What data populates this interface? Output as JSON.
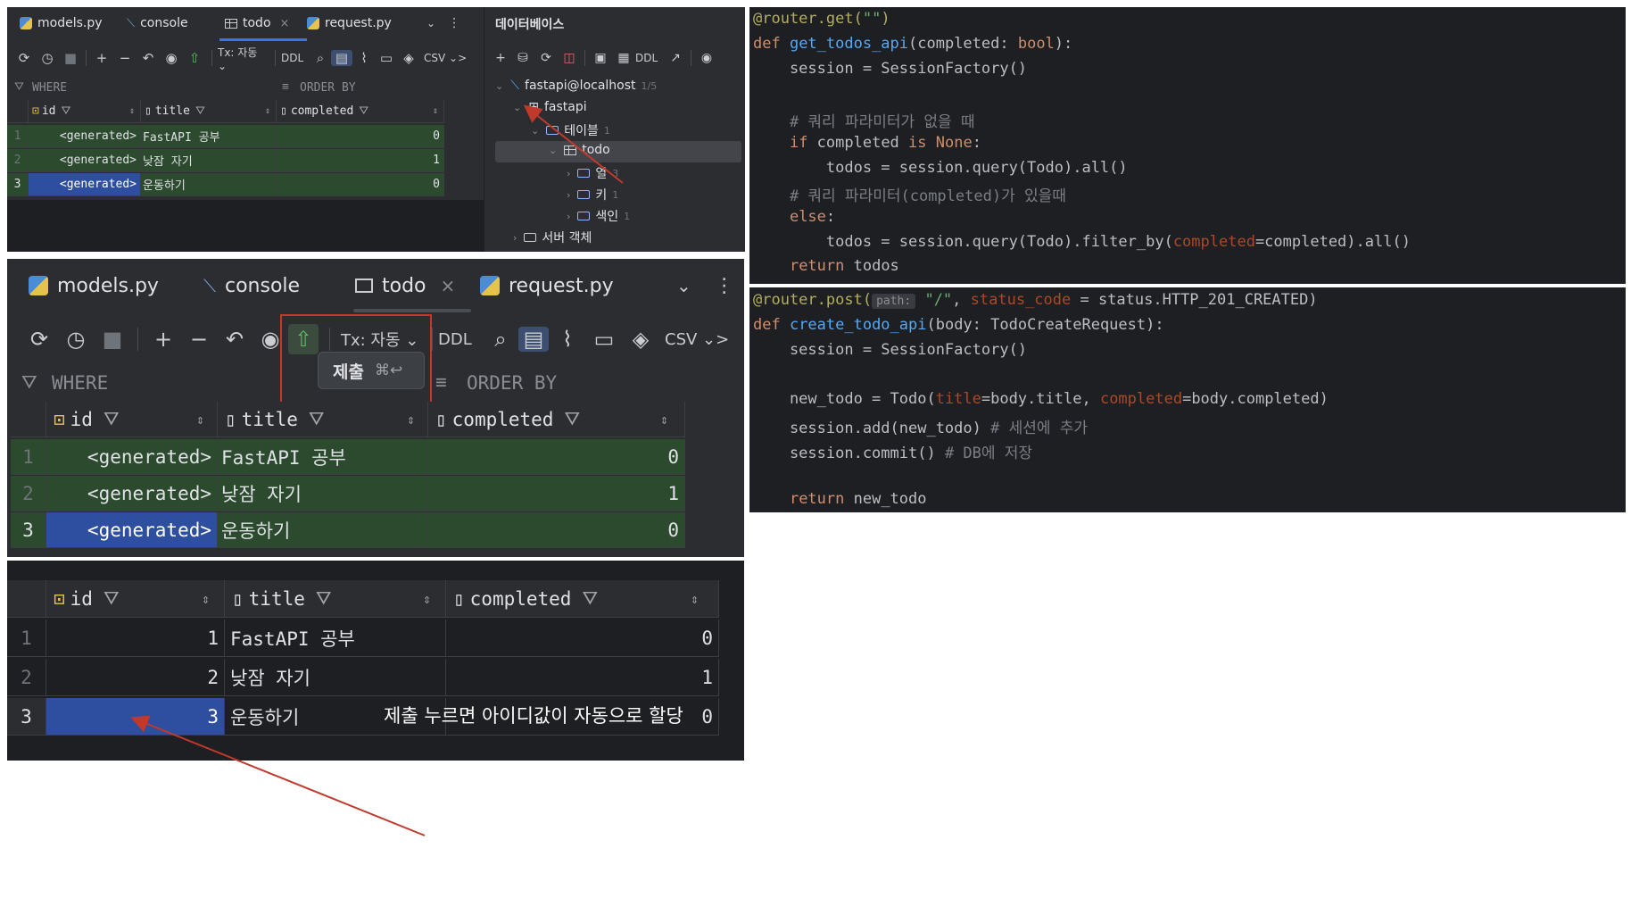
{
  "panel1": {
    "tabs": [
      {
        "label": "models.py",
        "icon": "python-file-icon"
      },
      {
        "label": "console",
        "icon": "console-icon"
      },
      {
        "label": "todo",
        "icon": "table-icon",
        "active": true
      },
      {
        "label": "request.py",
        "icon": "python-file-icon"
      }
    ],
    "tx_label": "Tx: 자동",
    "ddl_label": "DDL",
    "csv_label": "CSV",
    "where_label": "WHERE",
    "orderby_label": "ORDER BY",
    "columns": [
      "id",
      "title",
      "completed"
    ],
    "rows": [
      {
        "num": "1",
        "id": "<generated>",
        "title": "FastAPI 공부",
        "completed": "0"
      },
      {
        "num": "2",
        "id": "<generated>",
        "title": "낮잠 자기",
        "completed": "1"
      },
      {
        "num": "3",
        "id": "<generated>",
        "title": "운동하기",
        "completed": "0"
      }
    ]
  },
  "db_panel": {
    "title": "데이터베이스",
    "ddl_label": "DDL",
    "tree": {
      "connection": "fastapi@localhost",
      "connection_badge": "1/5",
      "schema": "fastapi",
      "tables_folder": "테이블",
      "tables_count": "1",
      "table": "todo",
      "columns_folder": "열",
      "columns_count": "3",
      "keys_folder": "키",
      "keys_count": "1",
      "index_folder": "색인",
      "index_count": "1",
      "server_objects": "서버 객체"
    }
  },
  "panel2": {
    "tabs": [
      {
        "label": "models.py",
        "icon": "python-file-icon"
      },
      {
        "label": "console",
        "icon": "console-icon"
      },
      {
        "label": "todo",
        "icon": "table-icon",
        "active": true
      },
      {
        "label": "request.py",
        "icon": "python-file-icon"
      }
    ],
    "tx_label": "Tx: 자동",
    "ddl_label": "DDL",
    "csv_label": "CSV",
    "tooltip_label": "제출",
    "tooltip_shortcut": "⌘↩",
    "where_label": "WHERE",
    "orderby_label": "ORDER BY",
    "columns": [
      "id",
      "title",
      "completed"
    ],
    "rows": [
      {
        "num": "1",
        "id": "<generated>",
        "title": "FastAPI 공부",
        "completed": "0"
      },
      {
        "num": "2",
        "id": "<generated>",
        "title": "낮잠 자기",
        "completed": "1"
      },
      {
        "num": "3",
        "id": "<generated>",
        "title": "운동하기",
        "completed": "0"
      }
    ]
  },
  "panel3": {
    "columns": [
      "id",
      "title",
      "completed"
    ],
    "rows": [
      {
        "num": "1",
        "id": "1",
        "title": "FastAPI 공부",
        "completed": "0"
      },
      {
        "num": "2",
        "id": "2",
        "title": "낮잠 자기",
        "completed": "1"
      },
      {
        "num": "3",
        "id": "3",
        "title": "운동하기",
        "completed": "0"
      }
    ],
    "annotation": "제출 누르면 아이디값이 자동으로 할당"
  },
  "code1": {
    "lines": [
      "@router.get(\"\")",
      "def get_todos_api(completed: bool):",
      "    session = SessionFactory()",
      "",
      "    # 쿼리 파라미터가 없을 때",
      "    if completed is None:",
      "        todos = session.query(Todo).all()",
      "    # 쿼리 파라미터(completed)가 있을때",
      "    else:",
      "        todos = session.query(Todo).filter_by(completed=completed).all()",
      "    return todos"
    ]
  },
  "code2": {
    "path_hint": "path:",
    "lines": [
      "@router.post(\"/\", status_code = status.HTTP_201_CREATED)",
      "def create_todo_api(body: TodoCreateRequest):",
      "    session = SessionFactory()",
      "",
      "    new_todo = Todo(title=body.title, completed=body.completed)",
      "    session.add(new_todo) # 세션에 추가",
      "    session.commit() # DB에 저장",
      "",
      "    return new_todo"
    ]
  },
  "colors": {
    "ide_bg": "#2b2d30",
    "grid_bg": "#1e1f22",
    "row_green": "#2b4a2e",
    "row_selected": "#2e4ea0",
    "annotation_red": "#c0392b",
    "accent_blue": "#3574f0"
  }
}
